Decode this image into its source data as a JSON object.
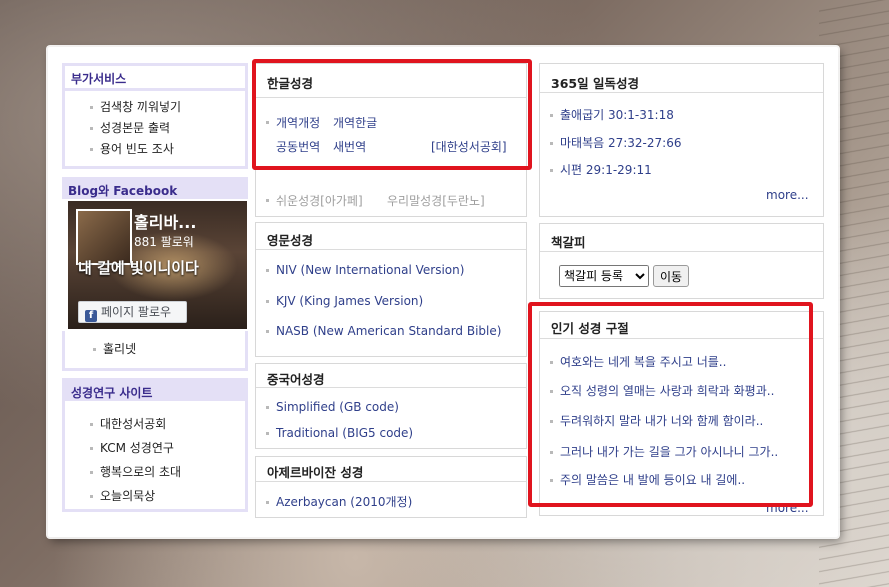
{
  "sidebar": {
    "extra_services": {
      "title": "부가서비스",
      "items": [
        "검색창 끼워넣기",
        "성경본문 출력",
        "용어 빈도 조사"
      ]
    },
    "blog": {
      "title": "Blog와 Facebook",
      "fb_name": "홀리바...",
      "fb_followers": "881 팔로워",
      "fb_verse": "내 길에 빛이니이다",
      "fb_follow_label": "페이지 팔로우",
      "items": [
        "홀리넷"
      ]
    },
    "research": {
      "title": "성경연구 사이트",
      "items": [
        "대한성서공회",
        "KCM 성경연구",
        "행복으로의 초대",
        "오늘의묵상"
      ]
    }
  },
  "korean_bible": {
    "title": "한글성경",
    "row1": [
      "개역개정",
      "개역한글"
    ],
    "row2": [
      "공동번역",
      "새번역"
    ],
    "publisher": "[대한성서공회]",
    "row3": [
      "쉬운성경[아가페]",
      "우리말성경[두란노]"
    ]
  },
  "english_bible": {
    "title": "영문성경",
    "items": [
      "NIV (New International Version)",
      "KJV (King James Version)",
      "NASB (New American Standard Bible)"
    ]
  },
  "chinese_bible": {
    "title": "중국어성경",
    "items": [
      "Simplified (GB code)",
      "Traditional (BIG5 code)"
    ]
  },
  "azerbaijani_bible": {
    "title": "아제르바이잔 성경",
    "items": [
      "Azerbaycan (2010개정)"
    ]
  },
  "daily_reading": {
    "title": "365일 일독성경",
    "items": [
      "출애굽기 30:1-31:18",
      "마태복음 27:32-27:66",
      "시편 29:1-29:11"
    ],
    "more": "more..."
  },
  "bookmark": {
    "title": "책갈피",
    "select_value": "책갈피 등록",
    "go_label": "이동"
  },
  "popular_verses": {
    "title": "인기 성경 구절",
    "items": [
      "여호와는 네게 복을 주시고 너를..",
      "오직 성령의 열매는 사랑과 희락과 화평과..",
      "두려워하지 말라 내가 너와 함께 함이라..",
      "그러나 내가 가는 길을 그가 아시나니 그가..",
      "주의 말씀은 내 발에 등이요 내 길에.."
    ],
    "more": "more..."
  },
  "colors": {
    "highlight": "#e0141e",
    "sidebar_title": "#3a2c8c",
    "link": "#2f3f8a",
    "facebook": "#3b5998"
  }
}
